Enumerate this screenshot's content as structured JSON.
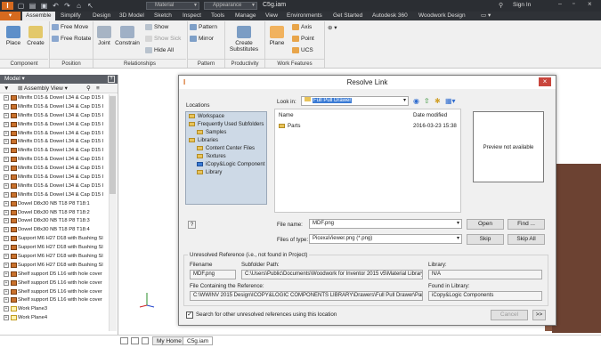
{
  "app": {
    "doc_title": "C5g.iam",
    "sign_in": "Sign In",
    "material_placeholder": "Material",
    "appearance_placeholder": "Appearance"
  },
  "tabs": [
    "Assemble",
    "Simplify",
    "Design",
    "3D Model",
    "Sketch",
    "Inspect",
    "Tools",
    "Manage",
    "View",
    "Environments",
    "Get Started",
    "Autodesk 360",
    "Woodwork Design"
  ],
  "ribbon": {
    "component": {
      "place": "Place",
      "create": "Create",
      "label": "Component"
    },
    "position": {
      "free_move": "Free Move",
      "free_rotate": "Free Rotate",
      "label": "Position"
    },
    "relationships": {
      "joint": "Joint",
      "constrain": "Constrain",
      "show": "Show",
      "show_sick": "Show Sick",
      "hide_all": "Hide All",
      "label": "Relationships"
    },
    "pattern": {
      "pattern": "Pattern",
      "mirror": "Mirror",
      "label": "Pattern"
    },
    "productivity": {
      "create_substitutes": "Create Substitutes",
      "label": "Productivity"
    },
    "work_features": {
      "plane": "Plane",
      "axis": "Axis",
      "point": "Point",
      "ucs": "UCS",
      "label": "Work Features"
    }
  },
  "browser": {
    "title": "Model",
    "view": "Assembly View",
    "items": [
      "Minifix D15 & Dowel L34 & Cap D15 I",
      "Minifix D15 & Dowel L34 & Cap D15 I",
      "Minifix D15 & Dowel L34 & Cap D15 I",
      "Minifix D15 & Dowel L34 & Cap D15 I",
      "Minifix D15 & Dowel L34 & Cap D15 I",
      "Minifix D15 & Dowel L34 & Cap D15 I",
      "Minifix D15 & Dowel L34 & Cap D15 I",
      "Minifix D15 & Dowel L34 & Cap D15 I",
      "Minifix D15 & Dowel L34 & Cap D15 I",
      "Minifix D15 & Dowel L34 & Cap D15 I",
      "Minifix D15 & Dowel L34 & Cap D15 I",
      "Minifix D15 & Dowel L34 & Cap D15 I",
      "Dowel D8x30 NB T18 P8 T18:1",
      "Dowel D8x30 NB T18 P8 T18:2",
      "Dowel D8x30 NB T18 P8 T18:3",
      "Dowel D8x30 NB T18 P8 T18:4",
      "Support M6 H27 D18 with Bushing Sl",
      "Support M6 H27 D18 with Bushing Sl",
      "Support M6 H27 D18 with Bushing Sl",
      "Support M6 H27 D18 with Bushing Sl",
      "Shelf support D5 L16 with hole cover",
      "Shelf support D5 L16 with hole cover",
      "Shelf support D5 L16 with hole cover",
      "Shelf support D5 L16 with hole cover",
      "Work Plane3",
      "Work Plane4"
    ]
  },
  "bottom_tabs": {
    "home": "My Home",
    "doc": "C5g.iam"
  },
  "dialog": {
    "title": "Resolve Link",
    "locations_label": "Locations",
    "locations": [
      "Workspace",
      "Frequently Used Subfolders",
      "Samples",
      "Libraries",
      "Content Center Files",
      "Textures",
      "iCopy&Logic Component",
      "Library"
    ],
    "look_in_label": "Look in:",
    "look_in_value": "Full Pull Drawer",
    "col_name": "Name",
    "col_date": "Date modified",
    "files": [
      {
        "name": "Parts",
        "date": "2016-03-23 15:38"
      }
    ],
    "preview": "Preview not available",
    "file_name_label": "File name:",
    "file_name_value": "MDF.png",
    "files_of_type_label": "Files of type:",
    "files_of_type_value": "PicexaViewer.png (*.png)",
    "open": "Open",
    "find": "Find ...",
    "skip": "Skip",
    "skip_all": "Skip All",
    "unresolved_header": "Unresolved Reference (i.e., not found in Project)",
    "filename_label": "Filename",
    "filename_value": "MDF.png",
    "subfolder_label": "Subfolder Path:",
    "subfolder_value": "C:\\Users\\Public\\Documents\\Woodwork for Inventor 2015 v5\\Material Library",
    "library_label": "Library:",
    "library_value": "N/A",
    "containing_label": "File Containing the Reference:",
    "containing_value": "C:\\WWINV 2015 Design\\ICOPY&LOGIC COMPONENTS LIBRARY\\Drawers\\Full Pull Drawer\\Parts\\Di",
    "found_label": "Found in Library:",
    "found_value": "iCopy&Logic Components",
    "search_checkbox": "Search for other unresolved references using this location",
    "cancel": "Cancel",
    "more": ">>"
  }
}
